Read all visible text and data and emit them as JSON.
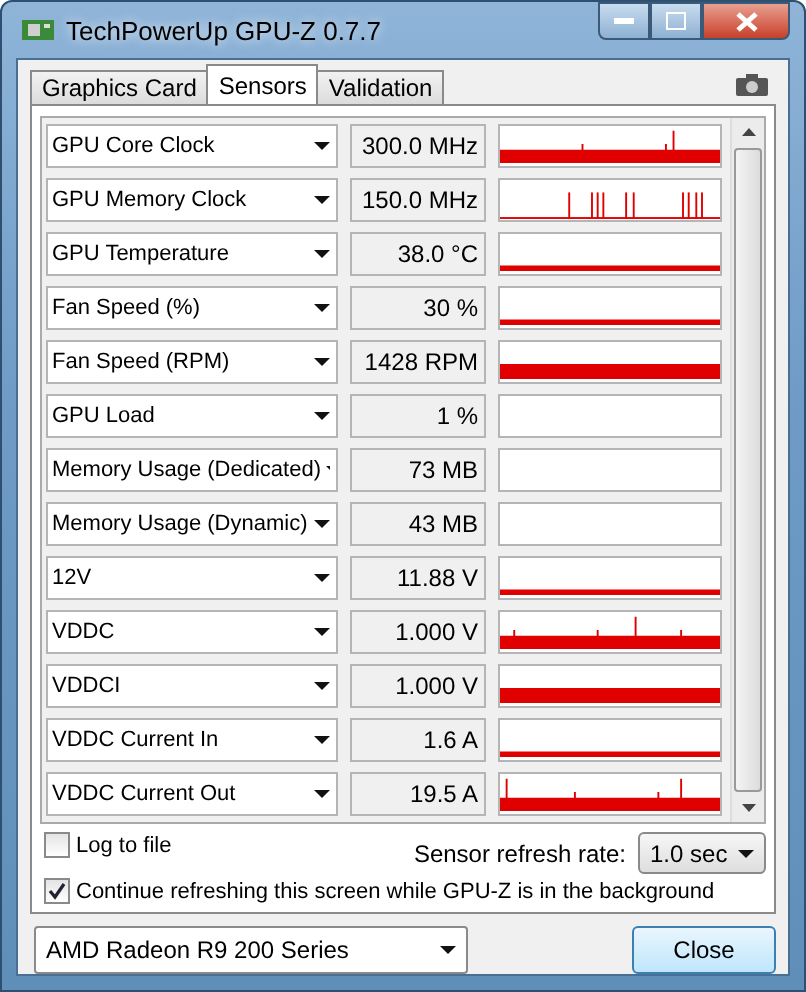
{
  "window": {
    "title": "TechPowerUp GPU-Z 0.7.7"
  },
  "tabs": [
    {
      "label": "Graphics Card",
      "selected": false
    },
    {
      "label": "Sensors",
      "selected": true
    },
    {
      "label": "Validation",
      "selected": false
    }
  ],
  "sensors": [
    {
      "name": "GPU Core Clock",
      "value": "300.0 MHz"
    },
    {
      "name": "GPU Memory Clock",
      "value": "150.0 MHz"
    },
    {
      "name": "GPU Temperature",
      "value": "38.0 °C"
    },
    {
      "name": "Fan Speed (%)",
      "value": "30 %"
    },
    {
      "name": "Fan Speed (RPM)",
      "value": "1428 RPM"
    },
    {
      "name": "GPU Load",
      "value": "1 %"
    },
    {
      "name": "Memory Usage (Dedicated)",
      "value": "73 MB"
    },
    {
      "name": "Memory Usage (Dynamic)",
      "value": "43 MB"
    },
    {
      "name": "12V",
      "value": "11.88 V"
    },
    {
      "name": "VDDC",
      "value": "1.000 V"
    },
    {
      "name": "VDDCI",
      "value": "1.000 V"
    },
    {
      "name": "VDDC Current In",
      "value": "1.6 A"
    },
    {
      "name": "VDDC Current Out",
      "value": "19.5 A"
    }
  ],
  "log_to_file": {
    "label": "Log to file",
    "checked": false
  },
  "refresh_rate": {
    "label": "Sensor refresh rate:",
    "value": "1.0 sec"
  },
  "continue_refreshing": {
    "label": "Continue refreshing this screen while GPU-Z is in the background",
    "checked": true
  },
  "gpu_select": {
    "value": "AMD Radeon R9 200 Series"
  },
  "buttons": [
    "Close"
  ]
}
